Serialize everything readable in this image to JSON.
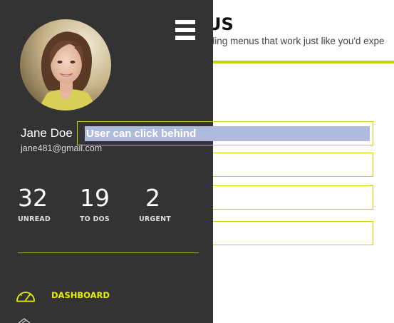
{
  "page": {
    "title_fragment": "US",
    "subtitle_fragment": "sliding menus that work just like you'd expe"
  },
  "overlay": {
    "hint_text": "User can click behind"
  },
  "profile": {
    "name": "Jane Doe",
    "email": "jane481@gmail.com",
    "avatar_icon": "user-photo"
  },
  "stats": [
    {
      "value": "32",
      "label": "UNREAD"
    },
    {
      "value": "19",
      "label": "TO DOS"
    },
    {
      "value": "2",
      "label": "URGENT"
    }
  ],
  "menu": {
    "items": [
      {
        "label": "DASHBOARD",
        "icon": "speedometer-icon",
        "active": true
      }
    ],
    "toggle_icon": "hamburger-icon"
  },
  "colors": {
    "menu_bg": "#333333",
    "accent": "#c4d600",
    "accent_text": "#e4f000",
    "hint_bg": "#aebbdc"
  }
}
